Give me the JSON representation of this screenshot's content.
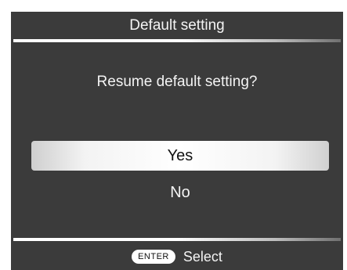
{
  "dialog": {
    "title": "Default setting",
    "question": "Resume default setting?",
    "options": [
      {
        "label": "Yes",
        "selected": true
      },
      {
        "label": "No",
        "selected": false
      }
    ]
  },
  "footer": {
    "key_label": "ENTER",
    "action_label": "Select"
  }
}
